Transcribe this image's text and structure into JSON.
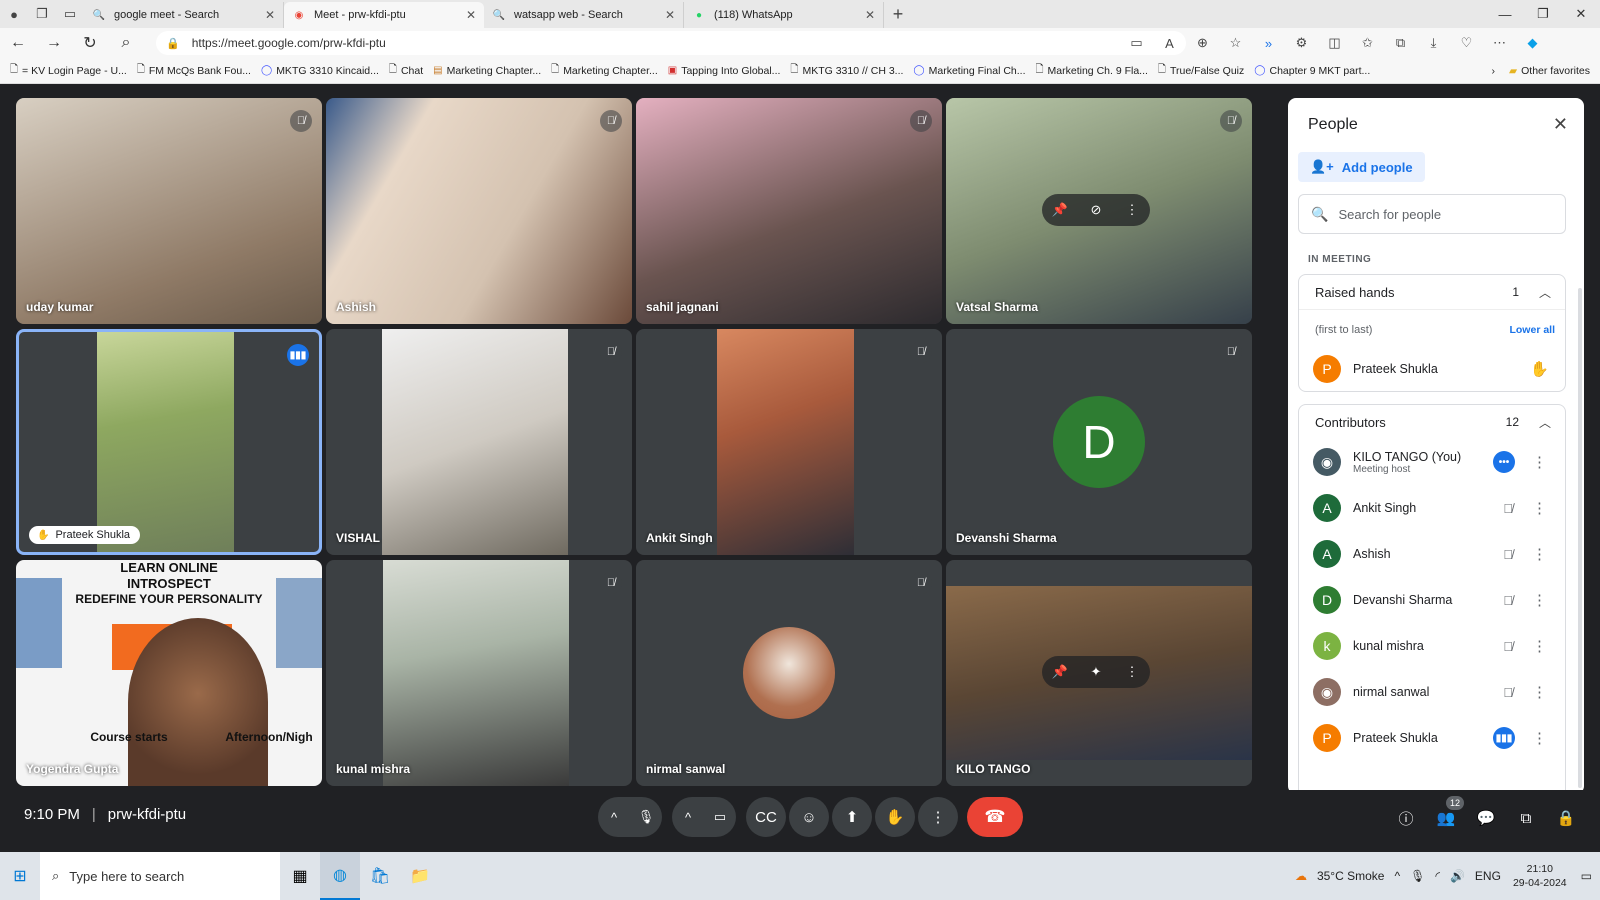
{
  "browser": {
    "tabs": [
      {
        "label": "google meet - Search",
        "icon": "search-icon",
        "active": false
      },
      {
        "label": "Meet - prw-kfdi-ptu",
        "icon": "meet-icon",
        "active": true
      },
      {
        "label": "watsapp web - Search",
        "icon": "search-icon",
        "active": false
      },
      {
        "label": "(118) WhatsApp",
        "icon": "whatsapp-icon",
        "active": false
      }
    ],
    "url": "https://meet.google.com/prw-kfdi-ptu",
    "bookmarks": [
      "= KV Login Page - U...",
      "FM McQs Bank Fou...",
      "MKTG 3310 Kincaid...",
      "Chat",
      "Marketing Chapter...",
      "Marketing Chapter...",
      "Tapping Into Global...",
      "MKTG 3310 // CH 3...",
      "Marketing Final Ch...",
      "Marketing Ch. 9 Fla...",
      "True/False Quiz",
      "Chapter 9 MKT part..."
    ],
    "other_favorites": "Other favorites"
  },
  "meeting": {
    "time": "9:10 PM",
    "code": "prw-kfdi-ptu",
    "tiles": [
      {
        "name": "uday kumar",
        "muted": true,
        "bg": "#b9a894"
      },
      {
        "name": "Ashish",
        "muted": true,
        "bg": "#c9b8a6"
      },
      {
        "name": "sahil jagnani",
        "muted": true,
        "bg": "#6b5a55"
      },
      {
        "name": "Vatsal Sharma",
        "muted": true,
        "bg": "#8a9a86"
      },
      {
        "name": "Prateek Shukla",
        "muted": false,
        "speaking": true,
        "bg": "#7a9c4e"
      },
      {
        "name": "VISHAL",
        "muted": true,
        "bg": "#cfcac2"
      },
      {
        "name": "Ankit Singh",
        "muted": true,
        "bg": "#8a5a4c"
      },
      {
        "name": "Devanshi Sharma",
        "muted": true,
        "avatar_letter": "D",
        "avatar_color": "#2e7d32"
      },
      {
        "name": "Yogendra Gupta",
        "muted": false,
        "bg": "#f4f4f4"
      },
      {
        "name": "kunal mishra",
        "muted": true,
        "bg": "#a9b4a6"
      },
      {
        "name": "nirmal sanwal",
        "muted": true,
        "avatar_photo": true
      },
      {
        "name": "KILO TANGO",
        "muted": false,
        "bg": "#6b5a45"
      }
    ],
    "poster": {
      "line1": "LEARN ONLINE",
      "line2": "INTROSPECT",
      "line3": "REDEFINE YOUR PERSONALITY",
      "line4": "Course starts",
      "line5": "Afternoon/Nigh"
    }
  },
  "people": {
    "title": "People",
    "add_people": "Add people",
    "search_placeholder": "Search for people",
    "section": "IN MEETING",
    "raised_hands": {
      "label": "Raised hands",
      "count": "1",
      "order": "(first to last)",
      "lower_all": "Lower all",
      "person": "Prateek Shukla"
    },
    "contributors": {
      "label": "Contributors",
      "count": "12",
      "list": [
        {
          "name": "KILO TANGO (You)",
          "sub": "Meeting host",
          "letter": "",
          "color": "#455a64",
          "status": "more"
        },
        {
          "name": "Ankit Singh",
          "sub": "",
          "letter": "A",
          "color": "#1e6b3a",
          "status": "muted"
        },
        {
          "name": "Ashish",
          "sub": "",
          "letter": "A",
          "color": "#1e6b3a",
          "status": "muted"
        },
        {
          "name": "Devanshi Sharma",
          "sub": "",
          "letter": "D",
          "color": "#2e7d32",
          "status": "muted"
        },
        {
          "name": "kunal mishra",
          "sub": "",
          "letter": "k",
          "color": "#7cb342",
          "status": "muted"
        },
        {
          "name": "nirmal sanwal",
          "sub": "",
          "letter": "",
          "color": "#8d6e63",
          "status": "muted"
        },
        {
          "name": "Prateek Shukla",
          "sub": "",
          "letter": "P",
          "color": "#f57c00",
          "status": "speaking"
        }
      ]
    }
  },
  "controls": {
    "people_badge": "12"
  },
  "taskbar": {
    "search_placeholder": "Type here to search",
    "weather": "35°C  Smoke",
    "lang": "ENG",
    "time": "21:10",
    "date": "29-04-2024"
  }
}
